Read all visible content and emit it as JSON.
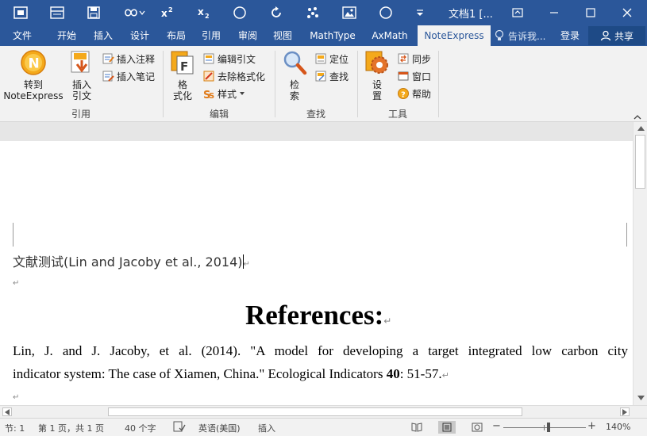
{
  "window": {
    "doc_title": "文档1 [...",
    "quick_access": [
      "save",
      "undo",
      "redo"
    ]
  },
  "tabs": [
    {
      "label": "文件",
      "active": false
    },
    {
      "label": "开始",
      "active": false
    },
    {
      "label": "插入",
      "active": false
    },
    {
      "label": "设计",
      "active": false
    },
    {
      "label": "布局",
      "active": false
    },
    {
      "label": "引用",
      "active": false
    },
    {
      "label": "审阅",
      "active": false
    },
    {
      "label": "视图",
      "active": false
    },
    {
      "label": "MathType",
      "active": false
    },
    {
      "label": "AxMath",
      "active": false
    },
    {
      "label": "NoteExpress",
      "active": true
    }
  ],
  "tell_me": "告诉我...",
  "login": "登录",
  "share": "共享",
  "ribbon": {
    "groups": [
      {
        "label": "引用",
        "big_buttons": [
          {
            "label": "转到\nNoteExpress",
            "icon": "noteexpress-logo-icon"
          },
          {
            "label": "插入\n引文",
            "icon": "insert-citation-icon"
          }
        ],
        "small_buttons": [
          {
            "label": "插入注释",
            "icon": "insert-note-icon"
          },
          {
            "label": "插入笔记",
            "icon": "insert-memo-icon"
          }
        ]
      },
      {
        "label": "编辑",
        "big_buttons": [
          {
            "label": "格\n式化",
            "icon": "format-icon"
          }
        ],
        "small_buttons": [
          {
            "label": "编辑引文",
            "icon": "edit-citation-icon"
          },
          {
            "label": "去除格式化",
            "icon": "remove-format-icon"
          },
          {
            "label": "样式",
            "icon": "style-icon"
          }
        ]
      },
      {
        "label": "查找",
        "big_buttons": [
          {
            "label": "检\n索",
            "icon": "search-magnifier-icon"
          }
        ],
        "small_buttons": [
          {
            "label": "定位",
            "icon": "locate-icon"
          },
          {
            "label": "查找",
            "icon": "find-icon"
          }
        ]
      },
      {
        "label": "工具",
        "big_buttons": [
          {
            "label": "设\n置",
            "icon": "settings-gear-icon"
          }
        ],
        "small_buttons": [
          {
            "label": "同步",
            "icon": "sync-icon"
          },
          {
            "label": "窗口",
            "icon": "window-icon"
          },
          {
            "label": "帮助",
            "icon": "help-icon"
          }
        ]
      }
    ]
  },
  "document": {
    "line1_text": "文献测试(Lin and Jacoby et al., 2014)",
    "heading": "References:",
    "ref_line1": "Lin, J. and J. Jacoby, et al. (2014). \"A model for developing a target integrated low carbon city",
    "ref_line2_a": "indicator system: The case of Xiamen, China.\" Ecological Indicators ",
    "ref_line2_vol": "40",
    "ref_line2_b": ": 51-57."
  },
  "status": {
    "section": "节: 1",
    "page": "第 1 页，共 1 页",
    "words": "40 个字",
    "language": "英语(美国)",
    "mode": "插入",
    "zoom": "140%",
    "zoom_level_percent": 140
  }
}
